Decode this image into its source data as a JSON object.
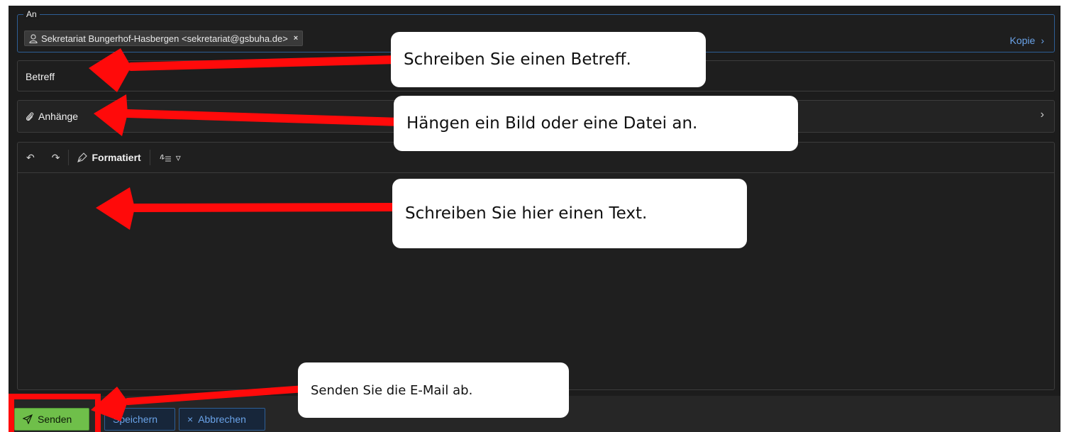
{
  "to": {
    "legend": "An",
    "recipient": "Sekretariat Bungerhof-Hasbergen <sekretariat@gsbuha.de>",
    "remove_glyph": "×",
    "cc_label": "Kopie",
    "cc_chevron": "›"
  },
  "subject": {
    "placeholder": "Betreff"
  },
  "attachments": {
    "label": "Anhänge",
    "chevron": "›"
  },
  "editor": {
    "undo_glyph": "↶",
    "redo_glyph": "↷",
    "format_label": "Formatiert",
    "dropdown_glyph": "▿"
  },
  "footer": {
    "send_label": "Senden",
    "save_label": "Speichern",
    "cancel_label": "Abbrechen",
    "cancel_glyph": "×"
  },
  "annotations": {
    "subject_hint": "Schreiben Sie einen Betreff.",
    "attach_hint": "Hängen ein Bild oder eine Datei an.",
    "body_hint": "Schreiben Sie hier einen Text.",
    "send_hint": "Senden Sie die E-Mail ab."
  },
  "colors": {
    "accent": "#2e5f96",
    "link": "#6aa3e8",
    "send_green": "#6fbf4a",
    "annotation_red": "#ff0a0a"
  }
}
